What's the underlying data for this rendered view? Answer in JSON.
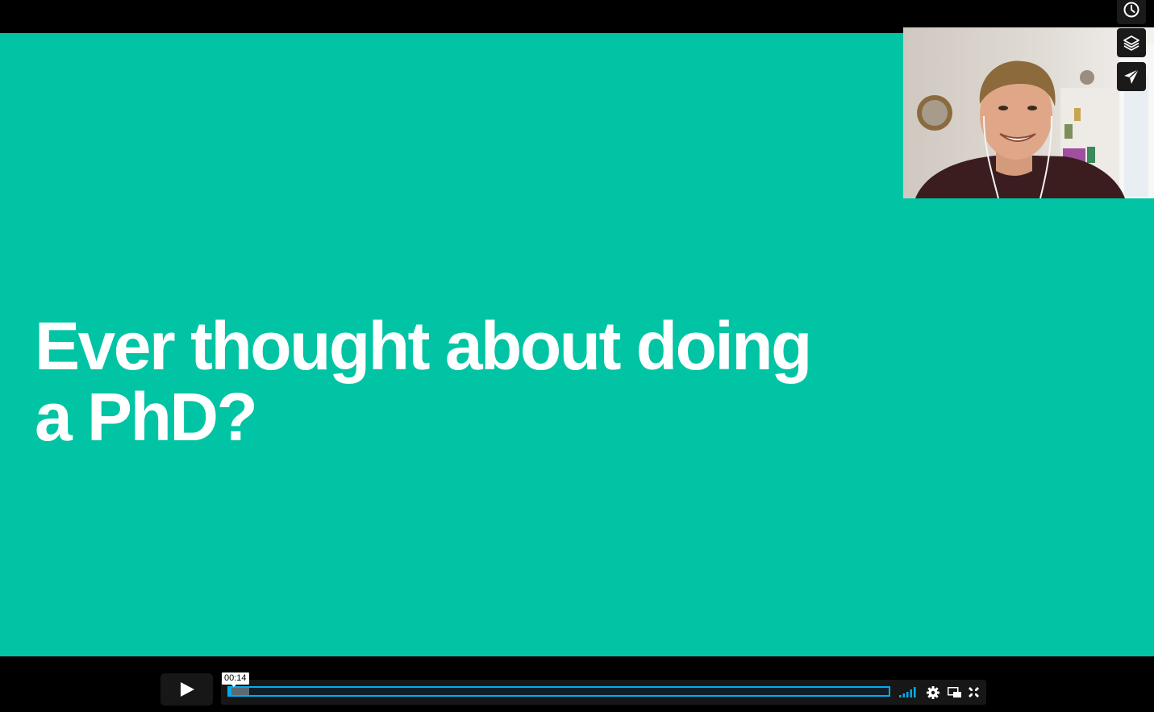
{
  "slide": {
    "background_color": "#00c4a3",
    "title_line1": "Ever thought about doing",
    "title_line2": "a PhD?"
  },
  "side_buttons": [
    {
      "name": "watch-later",
      "icon": "clock-icon"
    },
    {
      "name": "collections",
      "icon": "layers-icon"
    },
    {
      "name": "share",
      "icon": "paper-plane-icon"
    }
  ],
  "player": {
    "current_time": "00:14",
    "progress": 0.004,
    "loaded": 0.03,
    "accent_color": "#00adef",
    "icons": [
      "play-icon",
      "volume-bars-icon",
      "settings-gear-icon",
      "picture-in-picture-icon",
      "fullscreen-icon"
    ]
  }
}
